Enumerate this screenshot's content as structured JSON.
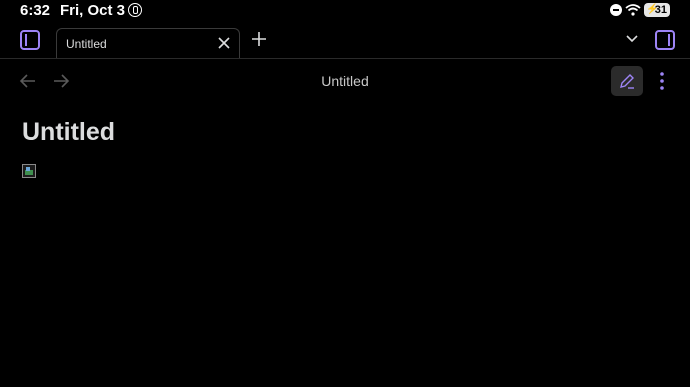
{
  "status_bar": {
    "time": "6:32",
    "date": "Fri, Oct 3",
    "battery": "31"
  },
  "tabs": [
    {
      "label": "Untitled",
      "active": true
    }
  ],
  "view_header": {
    "title": "Untitled"
  },
  "note": {
    "title": "Untitled"
  },
  "icons": {
    "left_sidebar": "sidebar-left-icon",
    "right_sidebar": "sidebar-right-icon",
    "close": "close-icon",
    "new_tab": "plus-icon",
    "tab_list": "chevron-down-icon",
    "back": "arrow-left-icon",
    "forward": "arrow-right-icon",
    "edit": "pencil-icon",
    "more": "more-vertical-icon"
  },
  "colors": {
    "accent": "#9d84f5",
    "background": "#000000",
    "text": "#dcddde"
  }
}
